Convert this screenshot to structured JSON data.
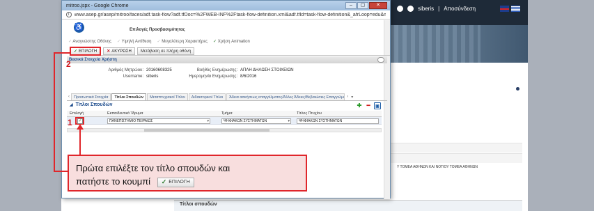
{
  "browser": {
    "tab_title": "mitroo.jspx - Google Chrome",
    "url": "www.asep.gr/asep/mitroo/faces/adf.task-flow?adf.tfDoc=%2FWEB-INF%2Ftask-flow-definition.xml&adf.tfId=task-flow-definition&_afrLoop=edu&mitrooValid"
  },
  "background_app": {
    "user_name": "siberis",
    "logout_label": "Αποσύνδεση",
    "side_text": "Υ ΤΟΜΕΑ ΑΘΗΝΩΝ ΚΑΙ ΝΟΤΙΟΥ ΤΟΜΕΑ ΑΘΗΝΩΝ",
    "footer_section_title": "Τίτλοι σπουδών"
  },
  "accessibility": {
    "title": "Επιλογές Προσβασιμότητας",
    "options": [
      {
        "label": "Αναγνώστης Οθόνης",
        "checked": false
      },
      {
        "label": "Υψηλή Αντίθεση",
        "checked": false
      },
      {
        "label": "Μεγαλύτερη Χαρακτήρες",
        "checked": false
      },
      {
        "label": "Χρήση Animation",
        "checked": true
      }
    ]
  },
  "toolbar": {
    "select_label": "ΕΠΙΛΟΓΗ",
    "cancel_label": "ΑΚΥΡΩΣΗ",
    "fullscreen_label": "Μετάβαση σε πλήρη οθόνη"
  },
  "user_info": {
    "section_title": "Βασικά Στοιχεία Χρήστη",
    "registry_label": "Αριθμός Μητρώου:",
    "registry_value": "20160608325",
    "username_label": "Username:",
    "username_value": "siberis",
    "aux_label": "Βοήθός Ενημέρωσης:",
    "aux_value": "ΑΠΛΗ ΔΗΛΩΣΗ ΣΤΟΙΧΕΙΩΝ",
    "date_label": "Ημερομηνία Ενημέρωσης:",
    "date_value": "8/6/2016"
  },
  "tabs": [
    "Προσωπικά Στοιχεία",
    "Τίτλοι Σπουδών",
    "Μεταπτυχιακοί Τίτλοι",
    "Διδακτορικοί Τίτλοι",
    "Άδεια ασκήσεως επαγγέλματος/Άλλες Άδειες/Βεβαιώσεις Επαγγελματικών"
  ],
  "active_tab_index": 1,
  "degrees": {
    "panel_title": "Τίτλοι Σπουδών",
    "columns": [
      "Επιλογή",
      "Εκπαιδευτικό Ίδρυμα",
      "Τμήμα",
      "Τίτλος Πτυχίου"
    ],
    "rows": [
      {
        "selected": true,
        "institution": "ΠΑΝΕΠΙΣΤΗΜΙΟ ΠΕΙΡΑΙΩΣ",
        "department": "ΨΗΦΙΑΚΩΝ ΣΥΣΤΗΜΑΤΩΝ",
        "title": "ΨΗΦΙΑΚΩΝ ΣΥΣΤΗΜΑΤΩΝ"
      }
    ]
  },
  "annotations": {
    "step1": "1",
    "step2": "2",
    "callout_line1": "Πρώτα επιλέξτε τον τίτλο σπουδών και",
    "callout_line2": "πατήστε το κουμπί",
    "callout_button_label": "ΕΠΙΛΟΓΗ"
  },
  "colors": {
    "annotation_red": "#e0262b",
    "callout_bg": "#f8dede",
    "link_blue": "#1c4b8c"
  }
}
